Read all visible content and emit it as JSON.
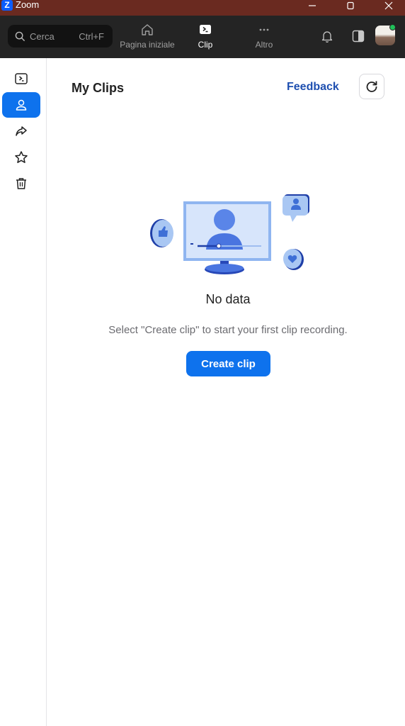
{
  "window": {
    "app_title": "Zoom",
    "logo_letter": "Z"
  },
  "topnav": {
    "search": {
      "placeholder": "Cerca",
      "shortcut": "Ctrl+F"
    },
    "tabs": [
      {
        "label": "Pagina iniziale",
        "icon": "home-icon",
        "active": false
      },
      {
        "label": "Clip",
        "icon": "clip-icon",
        "active": true
      },
      {
        "label": "Altro",
        "icon": "more-icon",
        "active": false
      }
    ],
    "icons": [
      "bell-icon",
      "panel-toggle-icon"
    ],
    "status_color": "#21c15a"
  },
  "sidebar": {
    "items": [
      {
        "name": "all-clips",
        "icon": "clip-play-icon",
        "active": false
      },
      {
        "name": "my-clips",
        "icon": "person-icon",
        "active": true
      },
      {
        "name": "shared-with-me",
        "icon": "share-icon",
        "active": false
      },
      {
        "name": "favorites",
        "icon": "star-icon",
        "active": false
      },
      {
        "name": "trash",
        "icon": "trash-icon",
        "active": false
      }
    ]
  },
  "main": {
    "title": "My Clips",
    "feedback_label": "Feedback",
    "empty_state": {
      "title": "No data",
      "description": "Select \"Create clip\" to start your first clip recording.",
      "button_label": "Create clip"
    }
  },
  "colors": {
    "accent": "#0e72ed",
    "titlebar": "#6a2a20",
    "nav": "#242424",
    "link": "#1e4fb0"
  }
}
